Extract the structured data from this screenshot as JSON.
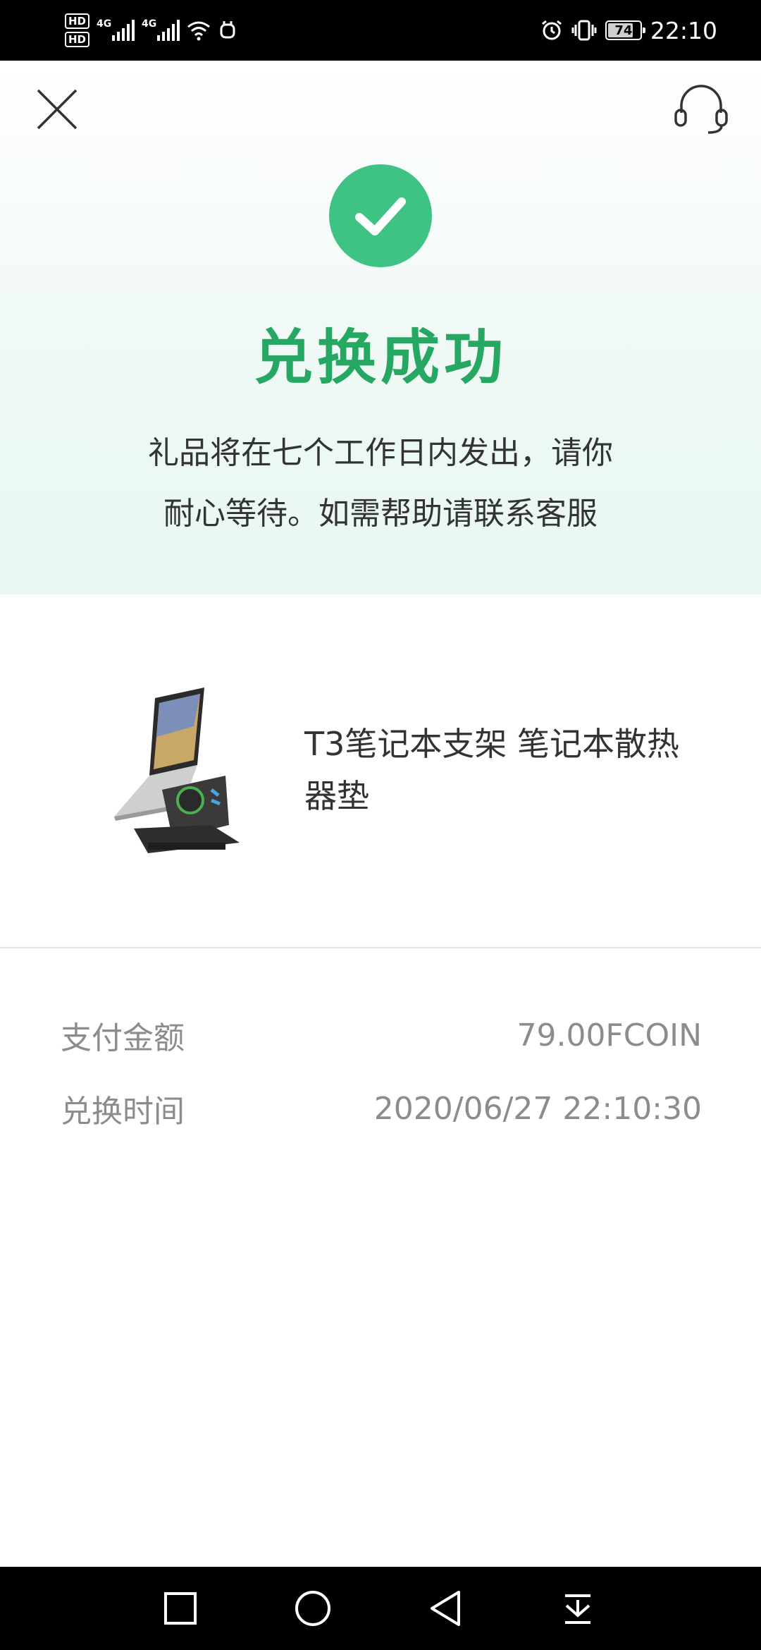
{
  "status_bar": {
    "hd1": "HD",
    "hd2": "HD",
    "net1": "4G",
    "net2": "4G",
    "battery": "74",
    "time": "22:10"
  },
  "header": {
    "close_icon": "close-icon",
    "support_icon": "headset-icon"
  },
  "result": {
    "title": "兑换成功",
    "message_line1": "礼品将在七个工作日内发出，请你",
    "message_line2": "耐心等待。如需帮助请联系客服",
    "accent_color": "#3ec385",
    "title_color": "#27a862"
  },
  "product": {
    "name": "T3笔记本支架 笔记本散热器垫"
  },
  "details": [
    {
      "label": "支付金额",
      "value": "79.00FCOIN"
    },
    {
      "label": "兑换时间",
      "value": "2020/06/27 22:10:30"
    }
  ],
  "nav": {
    "recent": "square-icon",
    "home": "circle-icon",
    "back": "triangle-back-icon",
    "notifications": "pull-down-icon"
  }
}
